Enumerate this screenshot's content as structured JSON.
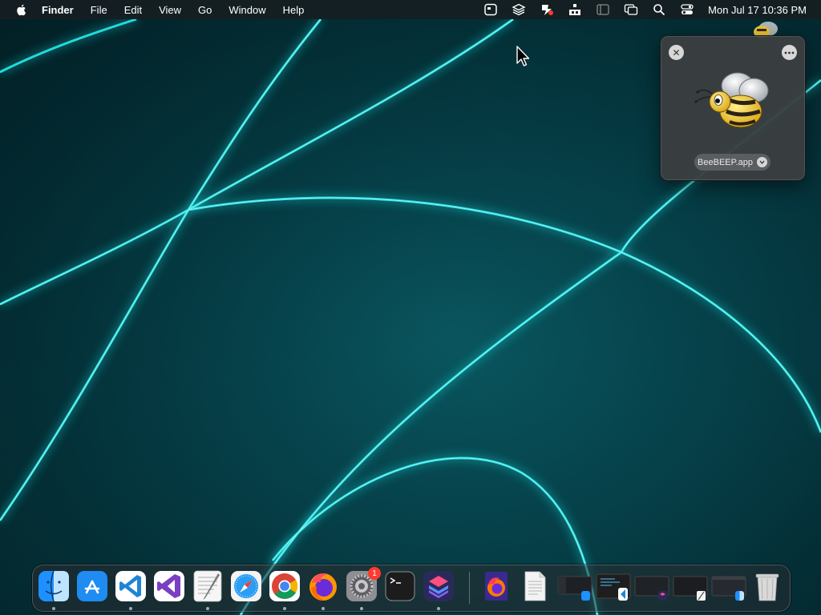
{
  "menubar": {
    "app_name": "Finder",
    "menus": [
      "File",
      "Edit",
      "View",
      "Go",
      "Window",
      "Help"
    ],
    "status_icons": [
      "screen-capture-icon",
      "layers-icon",
      "app-status-icon",
      "network-icon",
      "sidebar-icon",
      "window-switch-icon",
      "spotlight-search-icon",
      "control-center-icon"
    ],
    "clock": "Mon Jul 17  10:36 PM"
  },
  "preview": {
    "file_name": "BeeBEEP.app",
    "close_icon": "close-icon",
    "more_icon": "more-options-icon",
    "app_icon": "beebeep-bee-icon"
  },
  "dock": {
    "apps": [
      {
        "name": "Finder",
        "icon": "finder-icon",
        "running": true
      },
      {
        "name": "App Store",
        "icon": "app-store-icon",
        "running": false
      },
      {
        "name": "Visual Studio Code",
        "icon": "vscode-icon",
        "running": true
      },
      {
        "name": "Visual Studio",
        "icon": "visual-studio-icon",
        "running": false
      },
      {
        "name": "TextEdit",
        "icon": "textedit-icon",
        "running": true
      },
      {
        "name": "Safari",
        "icon": "safari-icon",
        "running": false
      },
      {
        "name": "Chrome",
        "icon": "chrome-icon",
        "running": true
      },
      {
        "name": "Firefox",
        "icon": "firefox-icon",
        "running": true
      },
      {
        "name": "System Settings",
        "icon": "settings-icon",
        "running": true,
        "badge": "1"
      },
      {
        "name": "Terminal",
        "icon": "terminal-icon",
        "running": false
      },
      {
        "name": "Shortcuts",
        "icon": "shortcuts-icon",
        "running": true
      }
    ],
    "recents": [
      "firefox-developer-icon",
      "document-icon"
    ],
    "minimized_windows": [
      "finder-window-thumb",
      "vscode-window-thumb",
      "shortcuts-window-thumb",
      "textedit-window-thumb",
      "finder-window-thumb-2"
    ],
    "trash_icon": "trash-icon"
  }
}
